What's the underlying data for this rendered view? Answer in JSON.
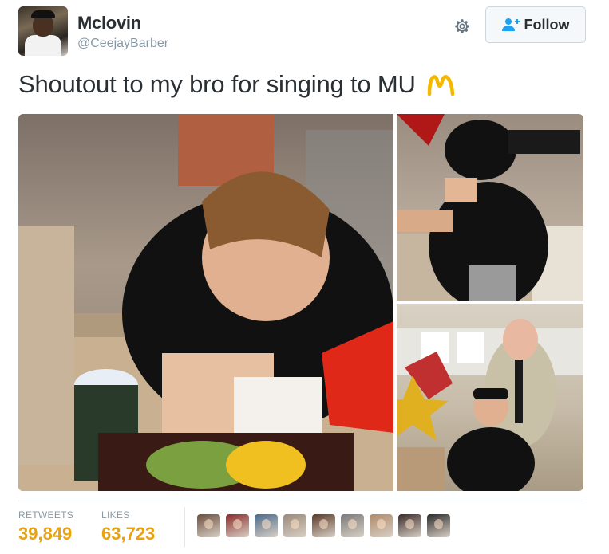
{
  "user": {
    "name": "Mclovin",
    "handle": "@CeejayBarber"
  },
  "actions": {
    "follow_label": "Follow",
    "settings_icon": "gear-icon",
    "follow_icon": "add-user-icon"
  },
  "tweet": {
    "text": "Shoutout to my bro for singing to MU",
    "emoji": "mcdonalds-arches"
  },
  "stats": {
    "retweets_label": "RETWEETS",
    "retweets_value": "39,849",
    "likes_label": "LIKES",
    "likes_value": "63,723"
  },
  "liker_colors": [
    "#6b4e3d",
    "#8a2a2a",
    "#4a6a8a",
    "#9a8a7a",
    "#5a3a2a",
    "#7a7a7a",
    "#b08a6a",
    "#3a2a2a",
    "#2a2a2a"
  ],
  "colors": {
    "stat_value": "#e8a30f",
    "muted": "#8899a6",
    "border": "#e1e8ed"
  }
}
